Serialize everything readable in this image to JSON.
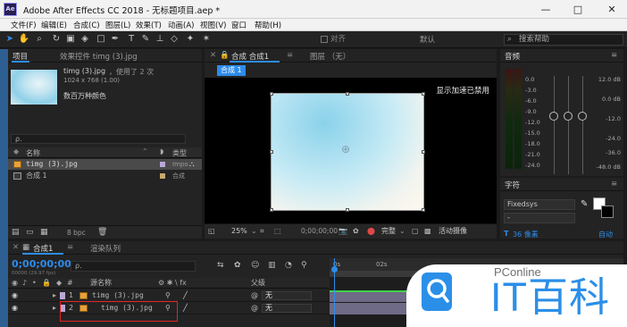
{
  "window": {
    "title": "Adobe After Effects CC 2018 - 无标题项目.aep *",
    "app_icon": "Ae",
    "minimize": "—",
    "maximize": "□",
    "close": "✕"
  },
  "menu": [
    "文件(F)",
    "编辑(E)",
    "合成(C)",
    "图层(L)",
    "效果(T)",
    "动画(A)",
    "视图(V)",
    "窗口",
    "帮助(H)"
  ],
  "toolbar": {
    "snap_label": "对齐",
    "workspace": "默认",
    "search_placeholder": "搜索帮助"
  },
  "project_panel": {
    "tab_project": "项目",
    "tab_effects": "效果控件 timg (3).jpg",
    "file_name": "timg (3).jpg",
    "usage": "，使用了 2 次",
    "dimensions": "1024 x 768 (1.00)",
    "color_mode": "数百万种颜色",
    "search_placeholder": "ρ.",
    "col_name": "名称",
    "col_type": "类型",
    "items": [
      {
        "name": "timg (3).jpg",
        "type": "Impo",
        "selected": true
      },
      {
        "name": "合成 1",
        "type": "合成",
        "selected": false
      }
    ],
    "bpc": "8 bpc"
  },
  "comp_viewer": {
    "tab_comp": "合成 合成1",
    "tab_layer": "图层 （无）",
    "breadcrumb": "合成 1",
    "gpu_hint": "显示加速已禁用",
    "zoom": "25%",
    "timecode": "0;00;00;00",
    "resolution": "完整",
    "active_camera": "活动摄像"
  },
  "audio_panel": {
    "title": "音频",
    "left_db": [
      "0.0",
      "-3.0",
      "-6.0",
      "-9.0",
      "-12.0",
      "-15.0",
      "-18.0",
      "-21.0",
      "-24.0"
    ],
    "right_db": [
      "12.0 dB",
      "0.0 dB",
      "-12.0",
      "-24.0",
      "-36.0",
      "-48.0 dB"
    ]
  },
  "character_panel": {
    "title": "字符",
    "font": "Fixedsys",
    "style": "-",
    "size_value": "36 像素",
    "leading": "自动"
  },
  "timeline": {
    "tab_comp": "合成1",
    "tab_render": "渲染队列",
    "timecode": "0;00;00;00",
    "timecode_sub": "00000 (29.97 fps)",
    "search_placeholder": "ρ.",
    "col_num": "#",
    "col_source": "源名称",
    "col_parent": "父级",
    "layers": [
      {
        "num": "1",
        "name": "timg (3).jpg",
        "parent": "无"
      },
      {
        "num": "2",
        "name": "timg (3).jpg",
        "parent": "无"
      }
    ],
    "ruler_labels": [
      "0s",
      "02s"
    ]
  },
  "watermark": {
    "brand_small": "PConline",
    "brand_big": "IT百科"
  },
  "colors": {
    "accent": "#2d8ceb",
    "highlight": "#e52424",
    "layer_label": "#b9a7d8"
  }
}
